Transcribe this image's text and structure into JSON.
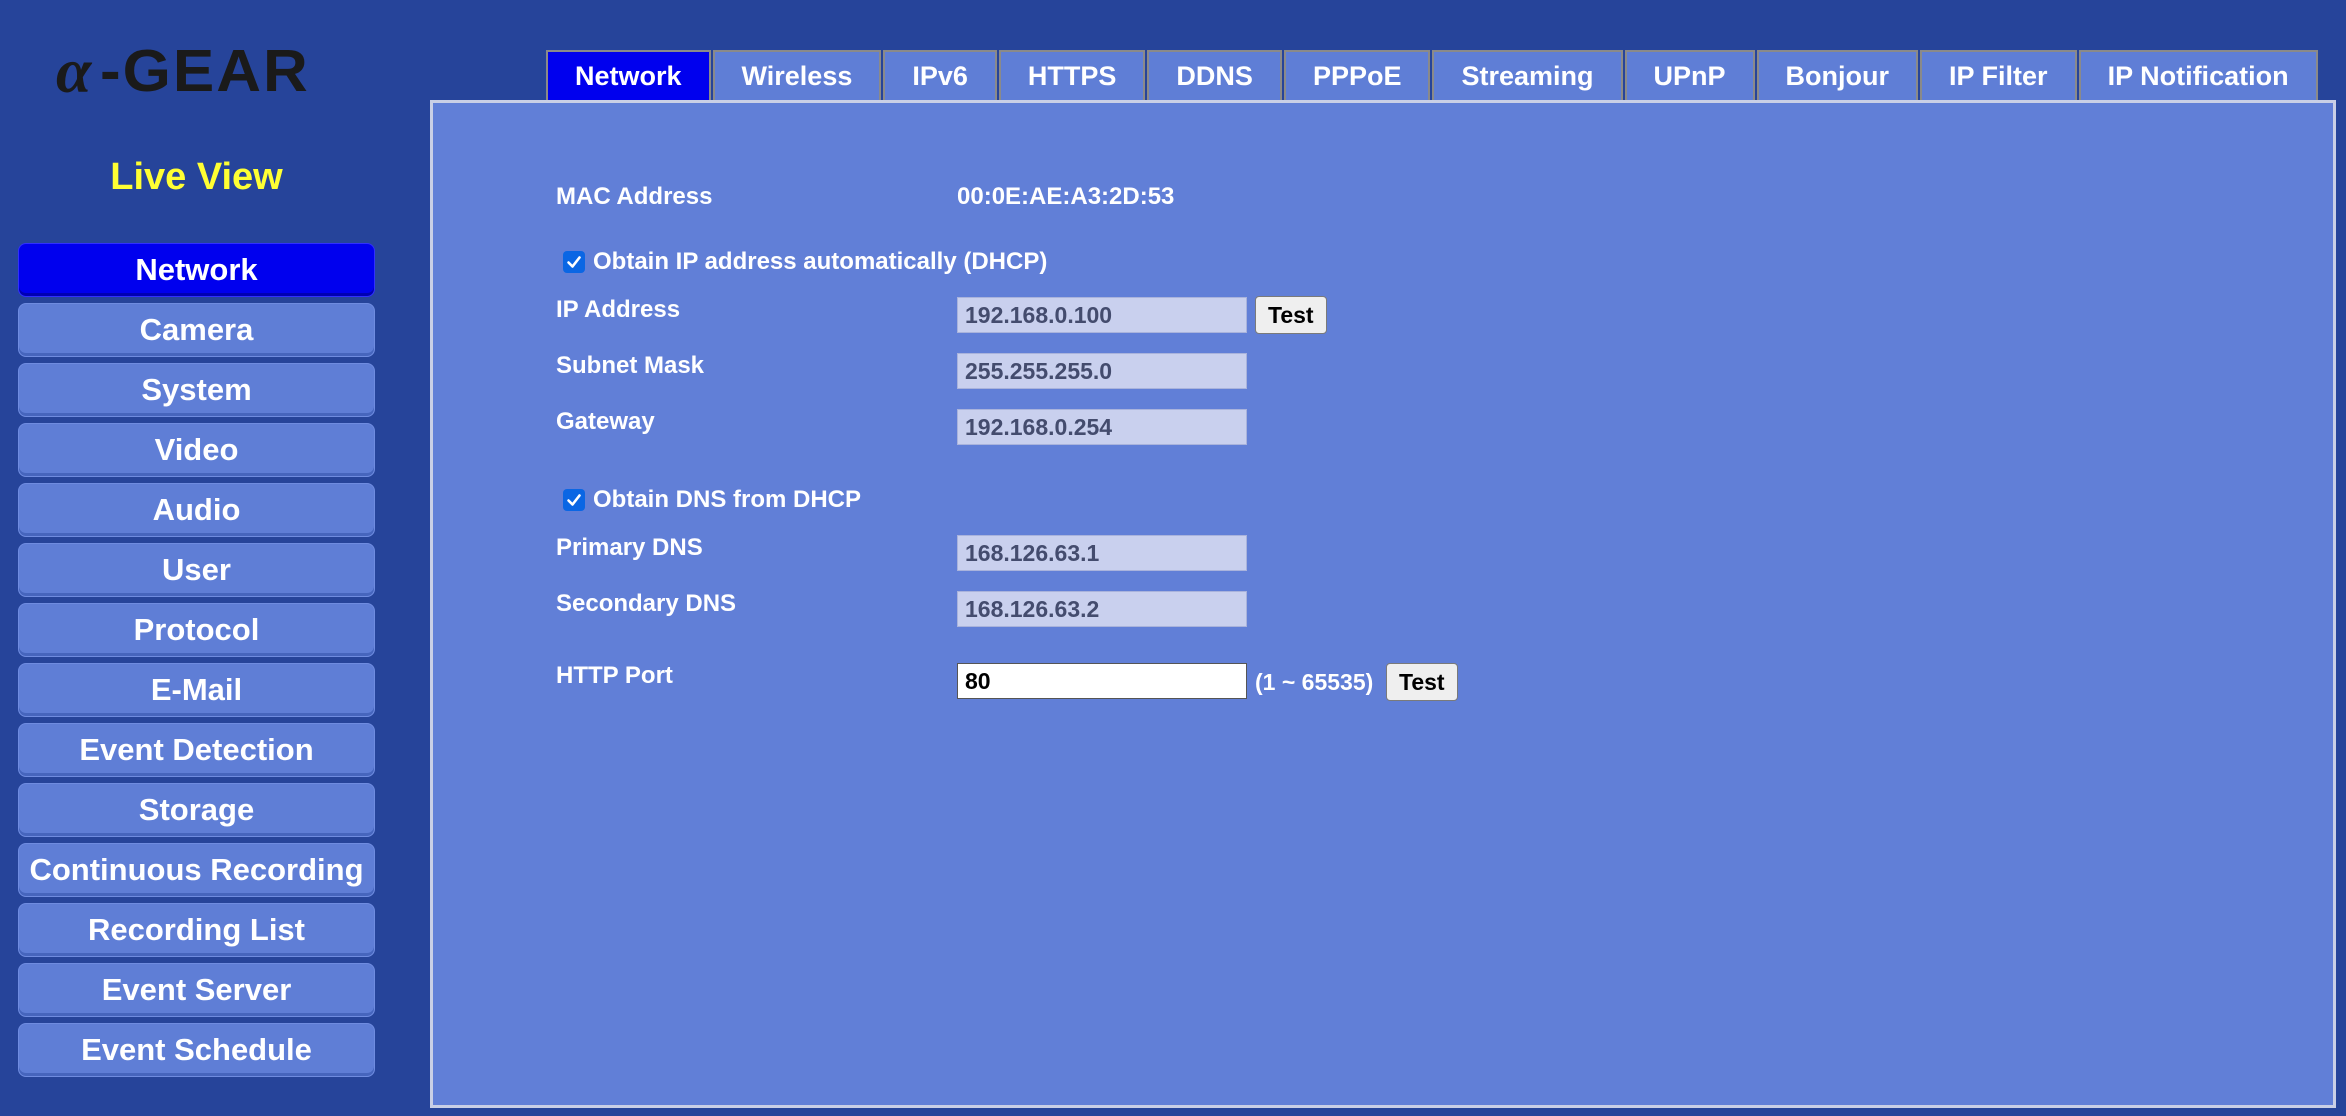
{
  "logo": {
    "text": "α-GEAR"
  },
  "live_view": "Live View",
  "sidebar": {
    "items": [
      {
        "label": "Network",
        "active": true
      },
      {
        "label": "Camera"
      },
      {
        "label": "System"
      },
      {
        "label": "Video"
      },
      {
        "label": "Audio"
      },
      {
        "label": "User"
      },
      {
        "label": "Protocol"
      },
      {
        "label": "E-Mail"
      },
      {
        "label": "Event Detection"
      },
      {
        "label": "Storage"
      },
      {
        "label": "Continuous Recording"
      },
      {
        "label": "Recording List"
      },
      {
        "label": "Event Server"
      },
      {
        "label": "Event Schedule"
      }
    ]
  },
  "tabs": [
    {
      "label": "Network",
      "active": true
    },
    {
      "label": "Wireless"
    },
    {
      "label": "IPv6"
    },
    {
      "label": "HTTPS"
    },
    {
      "label": "DDNS"
    },
    {
      "label": "PPPoE"
    },
    {
      "label": "Streaming"
    },
    {
      "label": "UPnP"
    },
    {
      "label": "Bonjour"
    },
    {
      "label": "IP Filter"
    },
    {
      "label": "IP Notification"
    }
  ],
  "form": {
    "mac_label": "MAC Address",
    "mac_value": "00:0E:AE:A3:2D:53",
    "dhcp_label": "Obtain IP address automatically (DHCP)",
    "dhcp_checked": true,
    "ip_label": "IP Address",
    "ip_value": "192.168.0.100",
    "test_label": "Test",
    "subnet_label": "Subnet Mask",
    "subnet_value": "255.255.255.0",
    "gateway_label": "Gateway",
    "gateway_value": "192.168.0.254",
    "dns_dhcp_label": "Obtain DNS from DHCP",
    "dns_dhcp_checked": true,
    "primary_dns_label": "Primary DNS",
    "primary_dns_value": "168.126.63.1",
    "secondary_dns_label": "Secondary DNS",
    "secondary_dns_value": "168.126.63.2",
    "http_port_label": "HTTP Port",
    "http_port_value": "80",
    "http_port_range": "(1 ~ 65535)"
  },
  "colors": {
    "background": "#26449a",
    "panel": "#617fd7",
    "active": "#0000ee",
    "live_view": "#ffff33",
    "checkbox": "#0a66e4"
  }
}
